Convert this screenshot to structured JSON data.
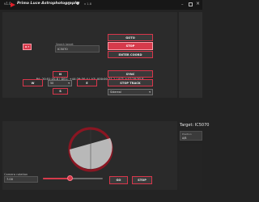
{
  "title_bar": {
    "version": "v1.0",
    "app_name": "Prima Luce Astrophotography",
    "settings_icon": "gear-icon",
    "info_icon": "info-icon",
    "extra": "v 1.8"
  },
  "mount": {
    "cmd_button": "0 ?",
    "search_label": "Search target",
    "search_value": "IC5070",
    "goto": "GOTO",
    "stop": "STOP",
    "enter_coord": "ENTER COORD",
    "info_line": "RA: 20:51:20.8 | DEC: +44:29:30.4 | AZ: 000:00:21.1 | ALT: +47:28:30.8"
  },
  "pad": {
    "north": "N",
    "west": "W",
    "east": "E",
    "south": "S",
    "speed_value": "50",
    "sync": "SYNC",
    "stop_track": "STOP TRACK",
    "tracking_value": "Sidereal"
  },
  "side": {
    "target_label": "Target: IC5070",
    "field_label": "Position",
    "field_value": "A/B"
  },
  "camera": {
    "rotation_label": "Camera rotation",
    "rotation_value": "7.00",
    "slider_fraction": 0.45,
    "go": "GO",
    "stop": "STOP"
  }
}
